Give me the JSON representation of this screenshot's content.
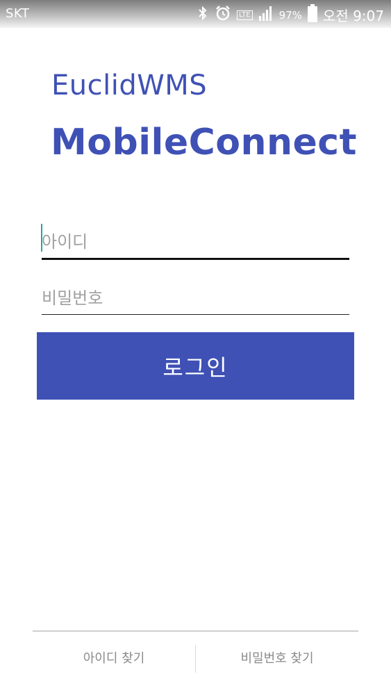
{
  "status_bar": {
    "carrier": "SKT",
    "battery_percent": "97%",
    "time": "오전 9:07",
    "network": "LTE",
    "icons": [
      "bluetooth-icon",
      "alarm-icon",
      "lte-icon",
      "signal-icon",
      "battery-icon"
    ]
  },
  "app": {
    "title_small": "EuclidWMS",
    "title_big": "MobileConnect"
  },
  "form": {
    "id_placeholder": "아이디",
    "id_value": "",
    "pw_placeholder": "비밀번호",
    "pw_value": "",
    "login_label": "로그인"
  },
  "links": {
    "find_id": "아이디 찾기",
    "find_pw": "비밀번호 찾기"
  },
  "colors": {
    "accent": "#3f51b5",
    "caret": "#26a69a"
  }
}
